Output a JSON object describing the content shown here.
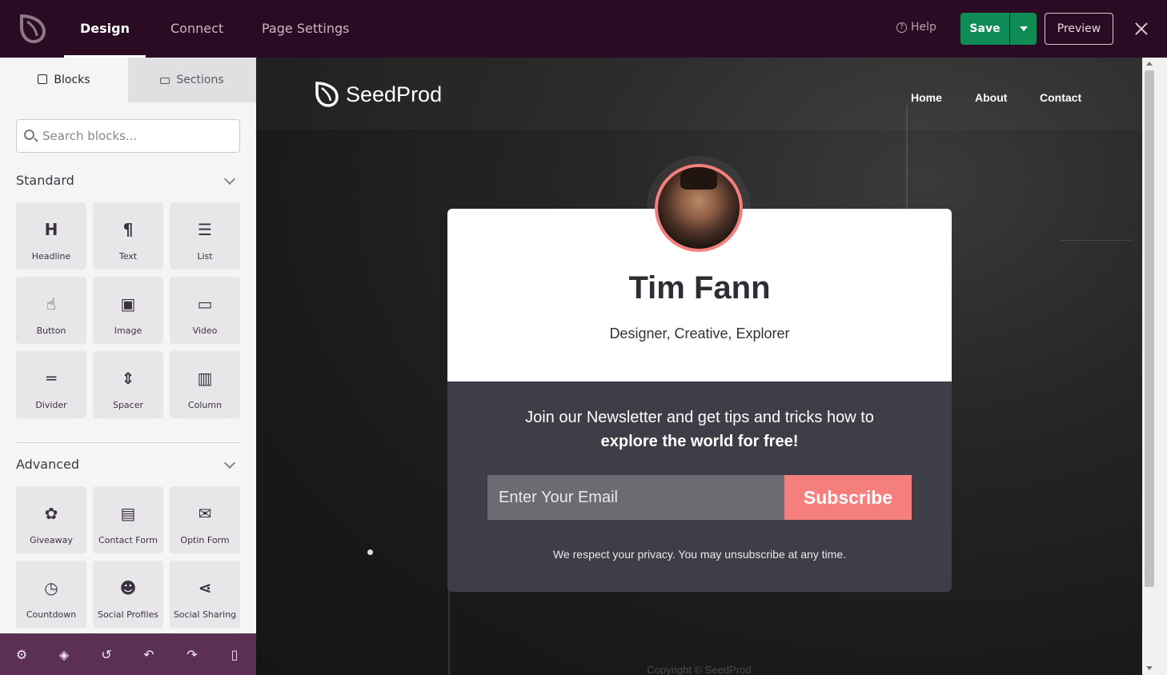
{
  "topbar": {
    "tabs": [
      {
        "label": "Design",
        "active": true
      },
      {
        "label": "Connect",
        "active": false
      },
      {
        "label": "Page Settings",
        "active": false
      }
    ],
    "help_label": "Help",
    "save_label": "Save",
    "preview_label": "Preview",
    "icons": {
      "logo": "seedprod-logo-icon",
      "help": "help-circle-icon",
      "caret": "caret-down-icon",
      "close": "close-icon"
    }
  },
  "sidebar": {
    "tabs": [
      {
        "label": "Blocks",
        "active": true
      },
      {
        "label": "Sections",
        "active": false
      }
    ],
    "search_placeholder": "Search blocks...",
    "groups": [
      {
        "title": "Standard",
        "blocks": [
          {
            "label": "Headline",
            "icon": "headline-icon",
            "glyph": "H"
          },
          {
            "label": "Text",
            "icon": "paragraph-icon",
            "glyph": "¶"
          },
          {
            "label": "List",
            "icon": "list-icon",
            "glyph": "☰"
          },
          {
            "label": "Button",
            "icon": "pointer-hand-icon",
            "glyph": "☝"
          },
          {
            "label": "Image",
            "icon": "image-icon",
            "glyph": "▣"
          },
          {
            "label": "Video",
            "icon": "video-camera-icon",
            "glyph": "▭"
          },
          {
            "label": "Divider",
            "icon": "divider-icon",
            "glyph": "═"
          },
          {
            "label": "Spacer",
            "icon": "spacer-icon",
            "glyph": "⇕"
          },
          {
            "label": "Column",
            "icon": "column-icon",
            "glyph": "▥"
          }
        ]
      },
      {
        "title": "Advanced",
        "blocks": [
          {
            "label": "Giveaway",
            "icon": "giveaway-icon",
            "glyph": "✿"
          },
          {
            "label": "Contact Form",
            "icon": "contact-form-icon",
            "glyph": "▤"
          },
          {
            "label": "Optin Form",
            "icon": "envelope-icon",
            "glyph": "✉"
          },
          {
            "label": "Countdown",
            "icon": "stopwatch-icon",
            "glyph": "◷"
          },
          {
            "label": "Social Profiles",
            "icon": "users-icon",
            "glyph": "☻"
          },
          {
            "label": "Social Sharing",
            "icon": "share-icon",
            "glyph": "⋖"
          }
        ]
      }
    ]
  },
  "bottombar": {
    "icons": [
      "settings-gear-icon",
      "layers-icon",
      "history-icon",
      "undo-icon",
      "redo-icon",
      "mobile-preview-icon"
    ],
    "glyphs": [
      "⚙",
      "◈",
      "↺",
      "↶",
      "↷",
      "▯"
    ]
  },
  "page": {
    "brand": "SeedProd",
    "nav": [
      "Home",
      "About",
      "Contact"
    ],
    "name": "Tim Fann",
    "tagline": "Designer, Creative, Explorer",
    "newsletter_line1": "Join our Newsletter and get tips and tricks how to",
    "newsletter_line2": "explore the world for free!",
    "email_placeholder": "Enter Your Email",
    "subscribe_label": "Subscribe",
    "privacy_text": "We respect your privacy. You may unsubscribe at any time.",
    "copyright": "Copyright © SeedProd"
  },
  "colors": {
    "topbar_bg": "#2b0b24",
    "save_green": "#0f8b56",
    "accent_coral": "#f47f7c",
    "card_dark": "#3e3e48",
    "bottombar_bg": "#5b3054"
  }
}
